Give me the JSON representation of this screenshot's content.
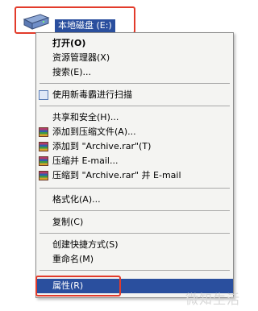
{
  "drive": {
    "icon": "hard-drive-icon",
    "label": "本地磁盘 (E:)"
  },
  "menu": {
    "open": "打开(O)",
    "explorer": "资源管理器(X)",
    "search": "搜索(E)...",
    "scan": "使用新毒霸进行扫描",
    "share": "共享和安全(H)...",
    "add_archive": "添加到压缩文件(A)...",
    "add_to_rar": "添加到 \"Archive.rar\"(T)",
    "compress_email": "压缩并 E-mail...",
    "compress_rar_email": "压缩到 \"Archive.rar\" 并 E-mail",
    "format": "格式化(A)...",
    "copy": "复制(C)",
    "shortcut": "创建快捷方式(S)",
    "rename": "重命名(M)",
    "properties": "属性(R)"
  },
  "colors": {
    "highlight": "#2a4f9e",
    "annotation": "#e23b2b"
  },
  "watermark": "微知生活"
}
